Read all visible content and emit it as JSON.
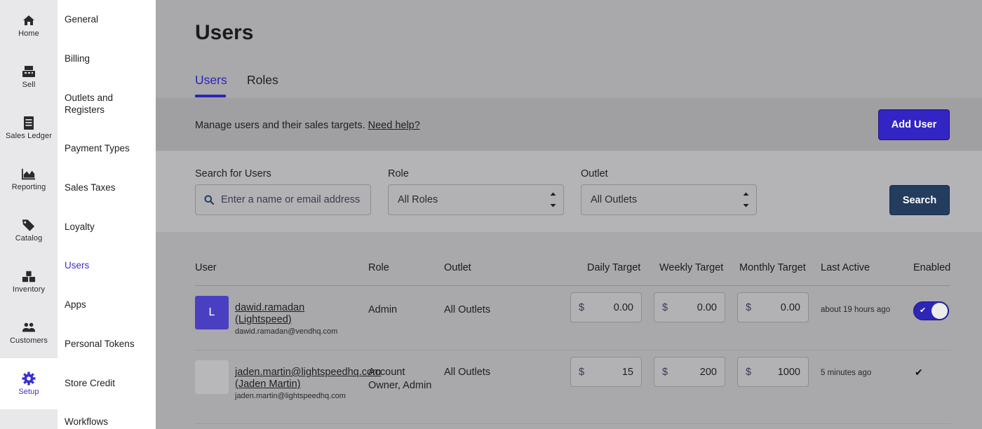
{
  "rail": {
    "items": [
      {
        "label": "Home",
        "icon": "home-icon"
      },
      {
        "label": "Sell",
        "icon": "register-icon"
      },
      {
        "label": "Sales Ledger",
        "icon": "ledger-icon"
      },
      {
        "label": "Reporting",
        "icon": "chart-icon"
      },
      {
        "label": "Catalog",
        "icon": "tag-icon"
      },
      {
        "label": "Inventory",
        "icon": "boxes-icon"
      },
      {
        "label": "Customers",
        "icon": "people-icon"
      },
      {
        "label": "Setup",
        "icon": "gear-icon",
        "active": true
      }
    ]
  },
  "subnav": {
    "items": [
      "General",
      "Billing",
      "Outlets and Registers",
      "Payment Types",
      "Sales Taxes",
      "Loyalty",
      "Users",
      "Apps",
      "Personal Tokens",
      "Store Credit",
      "Workflows"
    ],
    "active": "Users"
  },
  "page": {
    "title": "Users",
    "tabs": [
      {
        "label": "Users",
        "active": true
      },
      {
        "label": "Roles",
        "active": false
      }
    ],
    "description": "Manage users and their sales targets.",
    "help_link": "Need help?",
    "add_button": "Add User"
  },
  "filters": {
    "search_label": "Search for Users",
    "search_placeholder": "Enter a name or email address",
    "role_label": "Role",
    "role_value": "All Roles",
    "outlet_label": "Outlet",
    "outlet_value": "All Outlets",
    "search_button": "Search"
  },
  "table": {
    "headers": {
      "user": "User",
      "role": "Role",
      "outlet": "Outlet",
      "daily": "Daily Target",
      "weekly": "Weekly Target",
      "monthly": "Monthly Target",
      "last_active": "Last Active",
      "enabled": "Enabled"
    },
    "currency": "$",
    "rows": [
      {
        "initial": "L",
        "name": "dawid.ramadan (Lightspeed)",
        "email": "dawid.ramadan@vendhq.com",
        "role": "Admin",
        "outlet": "All Outlets",
        "daily": "0.00",
        "weekly": "0.00",
        "monthly": "0.00",
        "last_active": "about 19 hours ago",
        "enabled": true
      },
      {
        "initial": "",
        "name": "jaden.martin@lightspeedhq.com (Jaden Martin)",
        "email": "jaden.martin@lightspeedhq.com",
        "role": "Account Owner, Admin",
        "outlet": "All Outlets",
        "daily": "15",
        "weekly": "200",
        "monthly": "1000",
        "last_active": "5 minutes ago",
        "enabled": true
      }
    ]
  },
  "colors": {
    "accent": "#2c25b5",
    "add_button": "#3325c4",
    "search_button": "#243d5e",
    "avatar": "#4b3fc1"
  }
}
